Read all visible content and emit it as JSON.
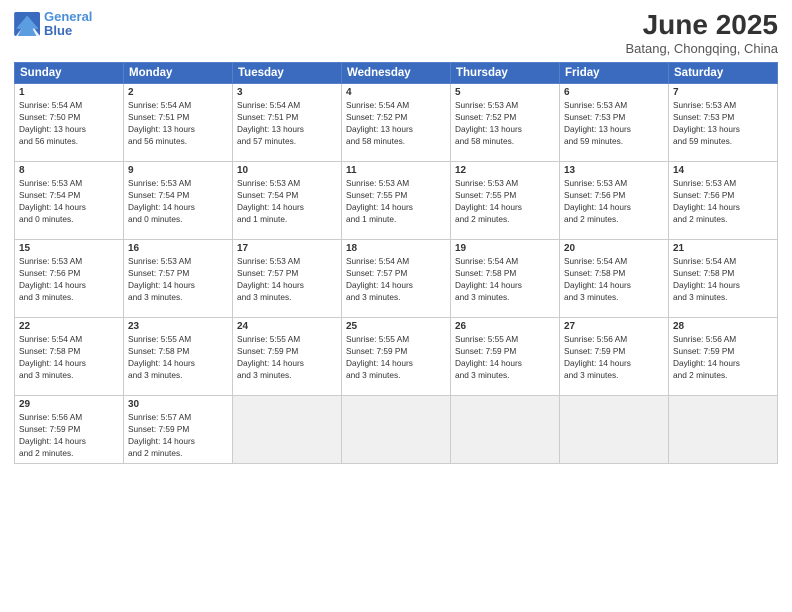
{
  "logo": {
    "line1": "General",
    "line2": "Blue"
  },
  "title": "June 2025",
  "subtitle": "Batang, Chongqing, China",
  "weekdays": [
    "Sunday",
    "Monday",
    "Tuesday",
    "Wednesday",
    "Thursday",
    "Friday",
    "Saturday"
  ],
  "weeks": [
    [
      {
        "day": 1,
        "sunrise": "5:54 AM",
        "sunset": "7:50 PM",
        "daylight": "13 hours and 56 minutes."
      },
      {
        "day": 2,
        "sunrise": "5:54 AM",
        "sunset": "7:51 PM",
        "daylight": "13 hours and 56 minutes."
      },
      {
        "day": 3,
        "sunrise": "5:54 AM",
        "sunset": "7:51 PM",
        "daylight": "13 hours and 57 minutes."
      },
      {
        "day": 4,
        "sunrise": "5:54 AM",
        "sunset": "7:52 PM",
        "daylight": "13 hours and 58 minutes."
      },
      {
        "day": 5,
        "sunrise": "5:53 AM",
        "sunset": "7:52 PM",
        "daylight": "13 hours and 58 minutes."
      },
      {
        "day": 6,
        "sunrise": "5:53 AM",
        "sunset": "7:53 PM",
        "daylight": "13 hours and 59 minutes."
      },
      {
        "day": 7,
        "sunrise": "5:53 AM",
        "sunset": "7:53 PM",
        "daylight": "13 hours and 59 minutes."
      }
    ],
    [
      {
        "day": 8,
        "sunrise": "5:53 AM",
        "sunset": "7:54 PM",
        "daylight": "14 hours and 0 minutes."
      },
      {
        "day": 9,
        "sunrise": "5:53 AM",
        "sunset": "7:54 PM",
        "daylight": "14 hours and 0 minutes."
      },
      {
        "day": 10,
        "sunrise": "5:53 AM",
        "sunset": "7:54 PM",
        "daylight": "14 hours and 1 minute."
      },
      {
        "day": 11,
        "sunrise": "5:53 AM",
        "sunset": "7:55 PM",
        "daylight": "14 hours and 1 minute."
      },
      {
        "day": 12,
        "sunrise": "5:53 AM",
        "sunset": "7:55 PM",
        "daylight": "14 hours and 2 minutes."
      },
      {
        "day": 13,
        "sunrise": "5:53 AM",
        "sunset": "7:56 PM",
        "daylight": "14 hours and 2 minutes."
      },
      {
        "day": 14,
        "sunrise": "5:53 AM",
        "sunset": "7:56 PM",
        "daylight": "14 hours and 2 minutes."
      }
    ],
    [
      {
        "day": 15,
        "sunrise": "5:53 AM",
        "sunset": "7:56 PM",
        "daylight": "14 hours and 3 minutes."
      },
      {
        "day": 16,
        "sunrise": "5:53 AM",
        "sunset": "7:57 PM",
        "daylight": "14 hours and 3 minutes."
      },
      {
        "day": 17,
        "sunrise": "5:53 AM",
        "sunset": "7:57 PM",
        "daylight": "14 hours and 3 minutes."
      },
      {
        "day": 18,
        "sunrise": "5:54 AM",
        "sunset": "7:57 PM",
        "daylight": "14 hours and 3 minutes."
      },
      {
        "day": 19,
        "sunrise": "5:54 AM",
        "sunset": "7:58 PM",
        "daylight": "14 hours and 3 minutes."
      },
      {
        "day": 20,
        "sunrise": "5:54 AM",
        "sunset": "7:58 PM",
        "daylight": "14 hours and 3 minutes."
      },
      {
        "day": 21,
        "sunrise": "5:54 AM",
        "sunset": "7:58 PM",
        "daylight": "14 hours and 3 minutes."
      }
    ],
    [
      {
        "day": 22,
        "sunrise": "5:54 AM",
        "sunset": "7:58 PM",
        "daylight": "14 hours and 3 minutes."
      },
      {
        "day": 23,
        "sunrise": "5:55 AM",
        "sunset": "7:58 PM",
        "daylight": "14 hours and 3 minutes."
      },
      {
        "day": 24,
        "sunrise": "5:55 AM",
        "sunset": "7:59 PM",
        "daylight": "14 hours and 3 minutes."
      },
      {
        "day": 25,
        "sunrise": "5:55 AM",
        "sunset": "7:59 PM",
        "daylight": "14 hours and 3 minutes."
      },
      {
        "day": 26,
        "sunrise": "5:55 AM",
        "sunset": "7:59 PM",
        "daylight": "14 hours and 3 minutes."
      },
      {
        "day": 27,
        "sunrise": "5:56 AM",
        "sunset": "7:59 PM",
        "daylight": "14 hours and 3 minutes."
      },
      {
        "day": 28,
        "sunrise": "5:56 AM",
        "sunset": "7:59 PM",
        "daylight": "14 hours and 2 minutes."
      }
    ],
    [
      {
        "day": 29,
        "sunrise": "5:56 AM",
        "sunset": "7:59 PM",
        "daylight": "14 hours and 2 minutes."
      },
      {
        "day": 30,
        "sunrise": "5:57 AM",
        "sunset": "7:59 PM",
        "daylight": "14 hours and 2 minutes."
      },
      null,
      null,
      null,
      null,
      null
    ]
  ],
  "labels": {
    "sunrise": "Sunrise:",
    "sunset": "Sunset:",
    "daylight": "Daylight hours"
  }
}
